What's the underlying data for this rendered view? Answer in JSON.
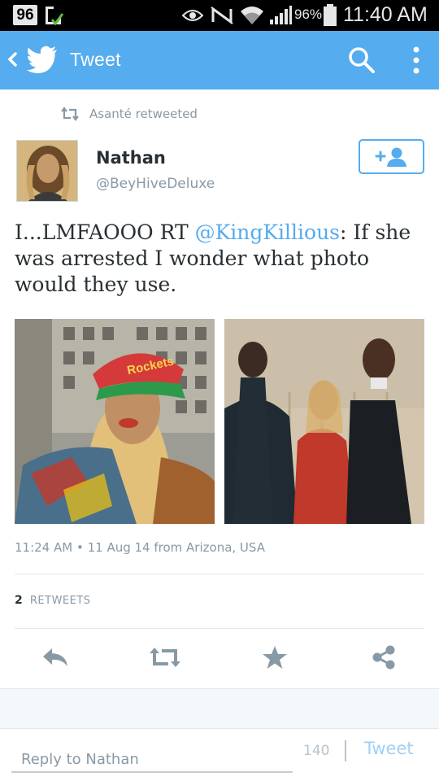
{
  "status_bar": {
    "notification_count": "96",
    "battery_percent": "96%",
    "time": "11:40 AM"
  },
  "header": {
    "title": "Tweet",
    "accent_color": "#55acee"
  },
  "retweet_context": {
    "text": "Asanté retweeted"
  },
  "tweet": {
    "author_name": "Nathan",
    "author_handle": "@BeyHiveDeluxe",
    "text_prefix": "I...LMFAOOO RT ",
    "mention": "@KingKillious",
    "text_suffix": ": If she was arrested I wonder what photo would they use.",
    "timestamp": "11:24 AM • 11 Aug 14",
    "from_label": "from Arizona, USA",
    "retweet_count": "2",
    "retweet_label": "RETWEETS",
    "photo_cap_text": "Rockets"
  },
  "actions": [
    {
      "name": "reply-icon"
    },
    {
      "name": "retweet-icon"
    },
    {
      "name": "favorite-star-icon"
    },
    {
      "name": "share-icon"
    }
  ],
  "reply_bar": {
    "placeholder": "Reply to Nathan",
    "char_count": "140",
    "submit_label": "Tweet"
  }
}
